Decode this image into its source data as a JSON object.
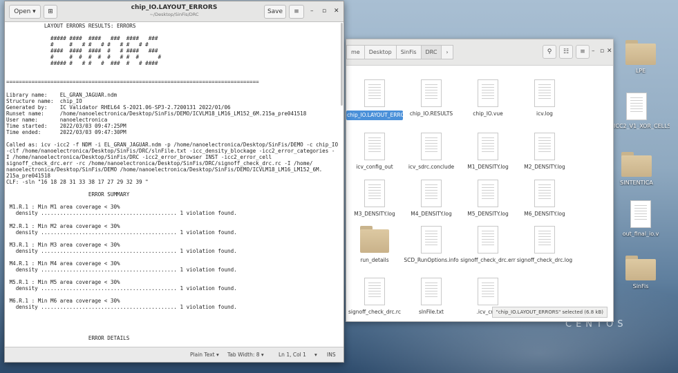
{
  "editor": {
    "open_label": "Open ▾",
    "save_label": "Save",
    "title": "chip_IO.LAYOUT_ERRORS",
    "subtitle": "~/Desktop/SinFis/DRC",
    "text": "            LAYOUT ERRORS RESULTS: ERRORS\n\n              ##### ####  ####   ###  ####   ###\n              #     #   # #   # #   # #   # #\n              ####  ####  ####  #   # ####   ###\n              #     #  #  #  #  #   # #  #      #\n              ##### #   # #   #  ###  #   # ####\n\n\n================================================================================\n\nLibrary name:    EL_GRAN_JAGUAR.ndm\nStructure name:  chip_IO\nGenerated by:    IC Validator RHEL64 S-2021.06-SP3-2.7200131 2022/01/06\nRunset name:     /home/nanoelectronica/Desktop/SinFis/DEMO/ICVLM18_LM16_LM152_6M.215a_pre041518\nUser name:       nanoelectronica\nTime started:    2022/03/03 09:47:25PM\nTime ended:      2022/03/03 09:47:30PM\n\nCalled as: icv -icc2 -f NDM -i EL_GRAN_JAGUAR.ndm -p /home/nanoelectronica/Desktop/SinFis/DEMO -c chip_IO\n-clf /home/nanoelectronica/Desktop/SinFis/DRC/slnFile.txt -icc_density_blockage -icc2_error_categories -\nI /home/nanoelectronica/Desktop/SinFis/DRC -icc2_error_browser INST -icc2_error_cell\nsignoff_check_drc.err -rc /home/nanoelectronica/Desktop/SinFis/DRC/signoff_check_drc.rc -I /home/\nnanoelectronica/Desktop/SinFis/DEMO /home/nanoelectronica/Desktop/SinFis/DEMO/ICVLM18_LM16_LM152_6M.\n215a_pre041518\nCLF: -sln \"16 18 28 31 33 38 17 27 29 32 39 \"\n\n                          ERROR SUMMARY\n\n M1.R.1 : Min M1 area coverage < 30%\n   density ........................................... 1 violation found.\n\n M2.R.1 : Min M2 area coverage < 30%\n   density ........................................... 1 violation found.\n\n M3.R.1 : Min M3 area coverage < 30%\n   density ........................................... 1 violation found.\n\n M4.R.1 : Min M4 area coverage < 30%\n   density ........................................... 1 violation found.\n\n M5.R.1 : Min M5 area coverage < 30%\n   density ........................................... 1 violation found.\n\n M6.R.1 : Min M6 area coverage < 30%\n   density ........................................... 1 violation found.\n\n\n\n\n                          ERROR DETAILS",
    "status_mode": "Plain Text ▾",
    "status_tab": "Tab Width: 8 ▾",
    "status_pos": "Ln 1, Col 1",
    "status_ins": "INS"
  },
  "files": {
    "crumbs": [
      "me",
      "Desktop",
      "SinFis",
      "DRC",
      "›"
    ],
    "items": [
      {
        "name": "chip_IO.LAYOUT_ERRORS",
        "type": "doc"
      },
      {
        "name": "chip_IO.RESULTS",
        "type": "doc"
      },
      {
        "name": "chip_IO.vue",
        "type": "doc"
      },
      {
        "name": "icv.log",
        "type": "doc"
      },
      {
        "name": "icv_config_out",
        "type": "doc"
      },
      {
        "name": "icv_sdrc.conclude",
        "type": "doc"
      },
      {
        "name": "M1_DENSITY.log",
        "type": "doc"
      },
      {
        "name": "M2_DENSITY.log",
        "type": "doc"
      },
      {
        "name": "M3_DENSITY.log",
        "type": "doc"
      },
      {
        "name": "M4_DENSITY.log",
        "type": "doc"
      },
      {
        "name": "M5_DENSITY.log",
        "type": "doc"
      },
      {
        "name": "M6_DENSITY.log",
        "type": "doc"
      },
      {
        "name": "run_details",
        "type": "folder"
      },
      {
        "name": "SCD_RunOptions.info",
        "type": "doc"
      },
      {
        "name": "signoff_check_drc.err",
        "type": "doc"
      },
      {
        "name": "signoff_check_drc.log",
        "type": "doc"
      },
      {
        "name": "signoff_check_drc.rc",
        "type": "doc"
      },
      {
        "name": "slnFile.txt",
        "type": "doc"
      },
      {
        "name": ".icv_cmd",
        "type": "doc"
      }
    ],
    "status": "\"chip_IO.LAYOUT_ERRORS\" selected (6.8 kB)"
  },
  "desktop": {
    "items": [
      {
        "name": "LPE",
        "type": "folder"
      },
      {
        "name": "PG_ICC2_V1_XOR_CELLS.tcl",
        "type": "doc"
      },
      {
        "name": "SINTENTICA",
        "type": "folder"
      },
      {
        "name": "out_final_io.v",
        "type": "doc"
      },
      {
        "name": "SinFis",
        "type": "folder"
      }
    ],
    "watermark": "CENTOS"
  },
  "colors": {
    "selection": "#4a90d9"
  }
}
